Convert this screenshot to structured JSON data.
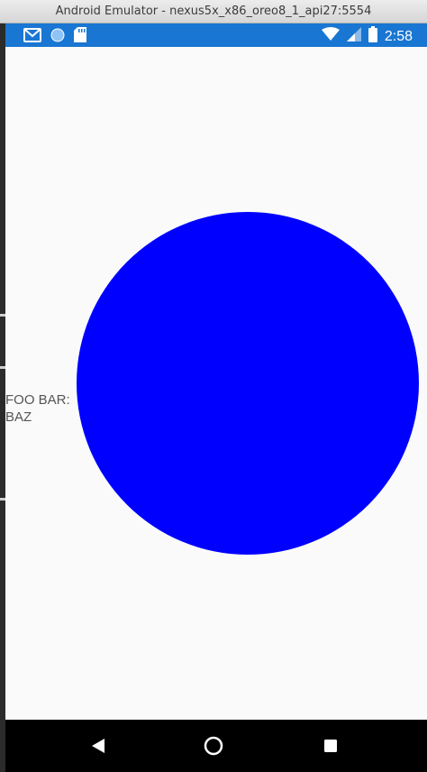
{
  "window": {
    "title": "Android Emulator - nexus5x_x86_oreo8_1_api27:5554"
  },
  "status_bar": {
    "time": "2:58",
    "color": "#1976d2",
    "left_icons": [
      "gmail-icon",
      "circle-notification-icon",
      "sd-card-icon"
    ],
    "right_icons": [
      "wifi-icon",
      "cellular-signal-icon",
      "battery-icon"
    ]
  },
  "content": {
    "label_line1": "FOO BAR:",
    "label_line2": "BAZ",
    "circle_color": "#0000ff"
  },
  "nav_bar": {
    "icons": [
      "back-icon",
      "home-icon",
      "recents-icon"
    ]
  }
}
